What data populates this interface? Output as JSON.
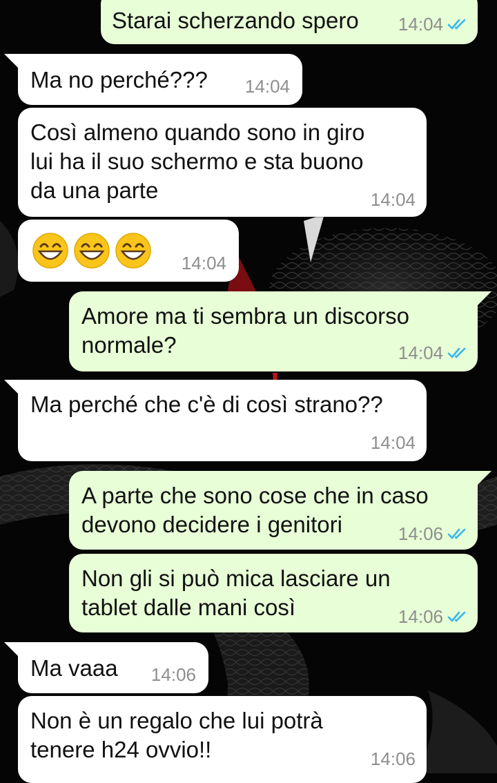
{
  "colors": {
    "incoming_bubble": "#ffffff",
    "outgoing_bubble": "#e7fed6",
    "read_ticks": "#34b7f1",
    "timestamp": "#8e8e8e",
    "wallpaper": "#050505"
  },
  "messages": [
    {
      "direction": "out",
      "lines": [
        "Starai scherzando spero"
      ],
      "time": "14:04",
      "status": "read"
    },
    {
      "direction": "in",
      "lines": [
        "Ma no perché???"
      ],
      "time": "14:04"
    },
    {
      "direction": "in",
      "lines": [
        "Così almeno quando sono in giro",
        "lui ha il suo schermo e sta buono",
        "da una parte"
      ],
      "time": "14:04"
    },
    {
      "direction": "in",
      "emoji": [
        "grinning-face-with-smiling-eyes",
        "grinning-face-with-smiling-eyes",
        "grinning-face-with-smiling-eyes"
      ],
      "time": "14:04"
    },
    {
      "direction": "out",
      "lines": [
        "Amore ma ti sembra un discorso",
        "normale?"
      ],
      "time": "14:04",
      "status": "read"
    },
    {
      "direction": "in",
      "lines": [
        "Ma perché che c'è di così strano??"
      ],
      "time": "14:04"
    },
    {
      "direction": "out",
      "lines": [
        "A parte che sono cose che in caso",
        "devono decidere i genitori"
      ],
      "time": "14:06",
      "status": "read"
    },
    {
      "direction": "out",
      "lines": [
        "Non gli si può mica lasciare un",
        "tablet dalle mani così"
      ],
      "time": "14:06",
      "status": "read"
    },
    {
      "direction": "in",
      "lines": [
        "Ma vaaa"
      ],
      "time": "14:06"
    },
    {
      "direction": "in",
      "lines": [
        "Non è un regalo che lui potrà",
        "tenere h24 ovvio!!"
      ],
      "time": "14:06"
    }
  ]
}
